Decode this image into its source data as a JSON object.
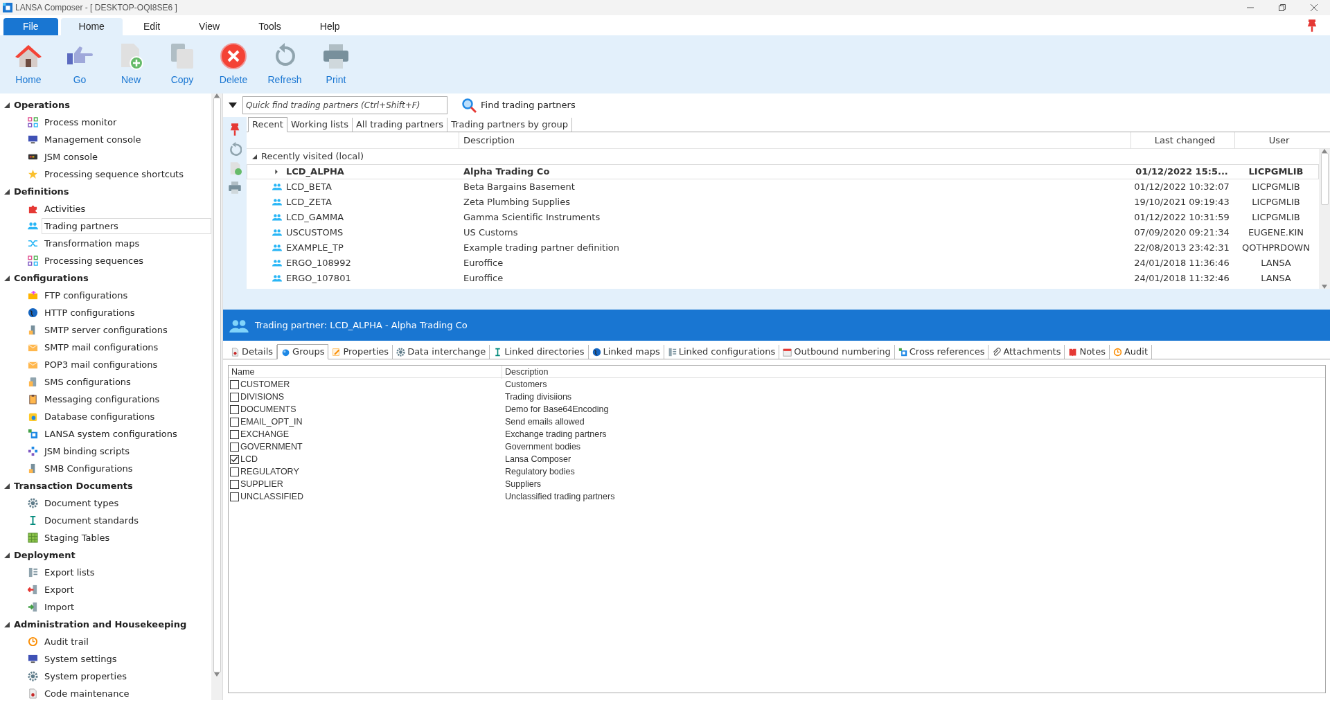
{
  "window": {
    "title": "LANSA Composer - [ DESKTOP-OQI8SE6 ]"
  },
  "menu_tabs": [
    {
      "label": "File",
      "kind": "file",
      "selected": false
    },
    {
      "label": "Home",
      "kind": "tab",
      "selected": true
    },
    {
      "label": "Edit",
      "kind": "tab",
      "selected": false
    },
    {
      "label": "View",
      "kind": "tab",
      "selected": false
    },
    {
      "label": "Tools",
      "kind": "tab",
      "selected": false
    },
    {
      "label": "Help",
      "kind": "tab",
      "selected": false
    }
  ],
  "ribbon": {
    "buttons": [
      "Home",
      "Go",
      "New",
      "Copy",
      "Delete",
      "Refresh",
      "Print"
    ]
  },
  "sidebar": {
    "groups": [
      {
        "label": "Operations",
        "expanded": true,
        "children": [
          {
            "label": "Process monitor",
            "selected": false
          },
          {
            "label": "Management console",
            "selected": false
          },
          {
            "label": "JSM console",
            "selected": false
          },
          {
            "label": "Processing sequence shortcuts",
            "selected": false
          }
        ]
      },
      {
        "label": "Definitions",
        "expanded": true,
        "children": [
          {
            "label": "Activities",
            "selected": false
          },
          {
            "label": "Trading partners",
            "selected": true
          },
          {
            "label": "Transformation maps",
            "selected": false
          },
          {
            "label": "Processing sequences",
            "selected": false
          }
        ]
      },
      {
        "label": "Configurations",
        "expanded": true,
        "children": [
          {
            "label": "FTP configurations",
            "selected": false
          },
          {
            "label": "HTTP configurations",
            "selected": false
          },
          {
            "label": "SMTP server configurations",
            "selected": false
          },
          {
            "label": "SMTP mail configurations",
            "selected": false
          },
          {
            "label": "POP3 mail configurations",
            "selected": false
          },
          {
            "label": "SMS configurations",
            "selected": false
          },
          {
            "label": "Messaging configurations",
            "selected": false
          },
          {
            "label": "Database configurations",
            "selected": false
          },
          {
            "label": "LANSA system configurations",
            "selected": false
          },
          {
            "label": "JSM binding scripts",
            "selected": false
          },
          {
            "label": "SMB Configurations",
            "selected": false
          }
        ]
      },
      {
        "label": "Transaction Documents",
        "expanded": true,
        "children": [
          {
            "label": "Document types",
            "selected": false
          },
          {
            "label": "Document standards",
            "selected": false
          },
          {
            "label": "Staging Tables",
            "selected": false
          }
        ]
      },
      {
        "label": "Deployment",
        "expanded": true,
        "children": [
          {
            "label": "Export lists",
            "selected": false
          },
          {
            "label": "Export",
            "selected": false
          },
          {
            "label": "Import",
            "selected": false
          }
        ]
      },
      {
        "label": "Administration and Housekeeping",
        "expanded": true,
        "children": [
          {
            "label": "Audit trail",
            "selected": false
          },
          {
            "label": "System settings",
            "selected": false
          },
          {
            "label": "System properties",
            "selected": false
          },
          {
            "label": "Code maintenance",
            "selected": false
          }
        ]
      }
    ]
  },
  "finder": {
    "placeholder": "Quick find trading partners (Ctrl+Shift+F)",
    "button": "Find trading partners"
  },
  "list_tabs": [
    {
      "label": "Recent",
      "selected": true
    },
    {
      "label": "Working lists",
      "selected": false
    },
    {
      "label": "All trading partners",
      "selected": false
    },
    {
      "label": "Trading partners by group",
      "selected": false
    }
  ],
  "list": {
    "columns": [
      "Description",
      "Last changed",
      "User"
    ],
    "groups": [
      {
        "label": "Recently visited (local)",
        "expanded": true,
        "rows": [
          {
            "name": "LCD_ALPHA",
            "description": "Alpha Trading Co",
            "last_changed": "01/12/2022 15:5...",
            "user": "LICPGMLIB",
            "selected": true
          },
          {
            "name": "LCD_BETA",
            "description": "Beta Bargains Basement",
            "last_changed": "01/12/2022 10:32:07",
            "user": "LICPGMLIB",
            "selected": false
          },
          {
            "name": "LCD_ZETA",
            "description": "Zeta Plumbing Supplies",
            "last_changed": "19/10/2021 09:19:43",
            "user": "LICPGMLIB",
            "selected": false
          },
          {
            "name": "LCD_GAMMA",
            "description": "Gamma Scientific Instruments",
            "last_changed": "01/12/2022 10:31:59",
            "user": "LICPGMLIB",
            "selected": false
          },
          {
            "name": "USCUSTOMS",
            "description": "US Customs",
            "last_changed": "07/09/2020 09:21:34",
            "user": "EUGENE.KIN",
            "selected": false
          },
          {
            "name": "EXAMPLE_TP",
            "description": "Example trading partner definition",
            "last_changed": "22/08/2013 23:42:31",
            "user": "QOTHPRDOWN",
            "selected": false
          },
          {
            "name": "ERGO_108992",
            "description": "Euroffice",
            "last_changed": "24/01/2018 11:36:46",
            "user": "LANSA",
            "selected": false
          },
          {
            "name": "ERGO_107801",
            "description": "Euroffice",
            "last_changed": "24/01/2018 11:32:46",
            "user": "LANSA",
            "selected": false
          }
        ]
      }
    ]
  },
  "detail": {
    "title": "Trading partner: LCD_ALPHA - Alpha Trading Co",
    "tabs": [
      {
        "label": "Details",
        "selected": false
      },
      {
        "label": "Groups",
        "selected": true
      },
      {
        "label": "Properties",
        "selected": false
      },
      {
        "label": "Data interchange",
        "selected": false
      },
      {
        "label": "Linked directories",
        "selected": false
      },
      {
        "label": "Linked maps",
        "selected": false
      },
      {
        "label": "Linked configurations",
        "selected": false
      },
      {
        "label": "Outbound numbering",
        "selected": false
      },
      {
        "label": "Cross references",
        "selected": false
      },
      {
        "label": "Attachments",
        "selected": false
      },
      {
        "label": "Notes",
        "selected": false
      },
      {
        "label": "Audit",
        "selected": false
      }
    ],
    "columns": [
      "Name",
      "Description"
    ],
    "rows": [
      {
        "name": "CUSTOMER",
        "description": "Customers",
        "checked": false
      },
      {
        "name": "DIVISIONS",
        "description": "Trading divisiions",
        "checked": false
      },
      {
        "name": "DOCUMENTS",
        "description": "Demo for Base64Encoding",
        "checked": false
      },
      {
        "name": "EMAIL_OPT_IN",
        "description": "Send emails allowed",
        "checked": false
      },
      {
        "name": "EXCHANGE",
        "description": "Exchange trading partners",
        "checked": false
      },
      {
        "name": "GOVERNMENT",
        "description": "Government bodies",
        "checked": false
      },
      {
        "name": "LCD",
        "description": "Lansa Composer",
        "checked": true
      },
      {
        "name": "REGULATORY",
        "description": "Regulatory bodies",
        "checked": false
      },
      {
        "name": "SUPPLIER",
        "description": "Suppliers",
        "checked": false
      },
      {
        "name": "UNCLASSIFIED",
        "description": "Unclassified trading partners",
        "checked": false
      }
    ]
  }
}
